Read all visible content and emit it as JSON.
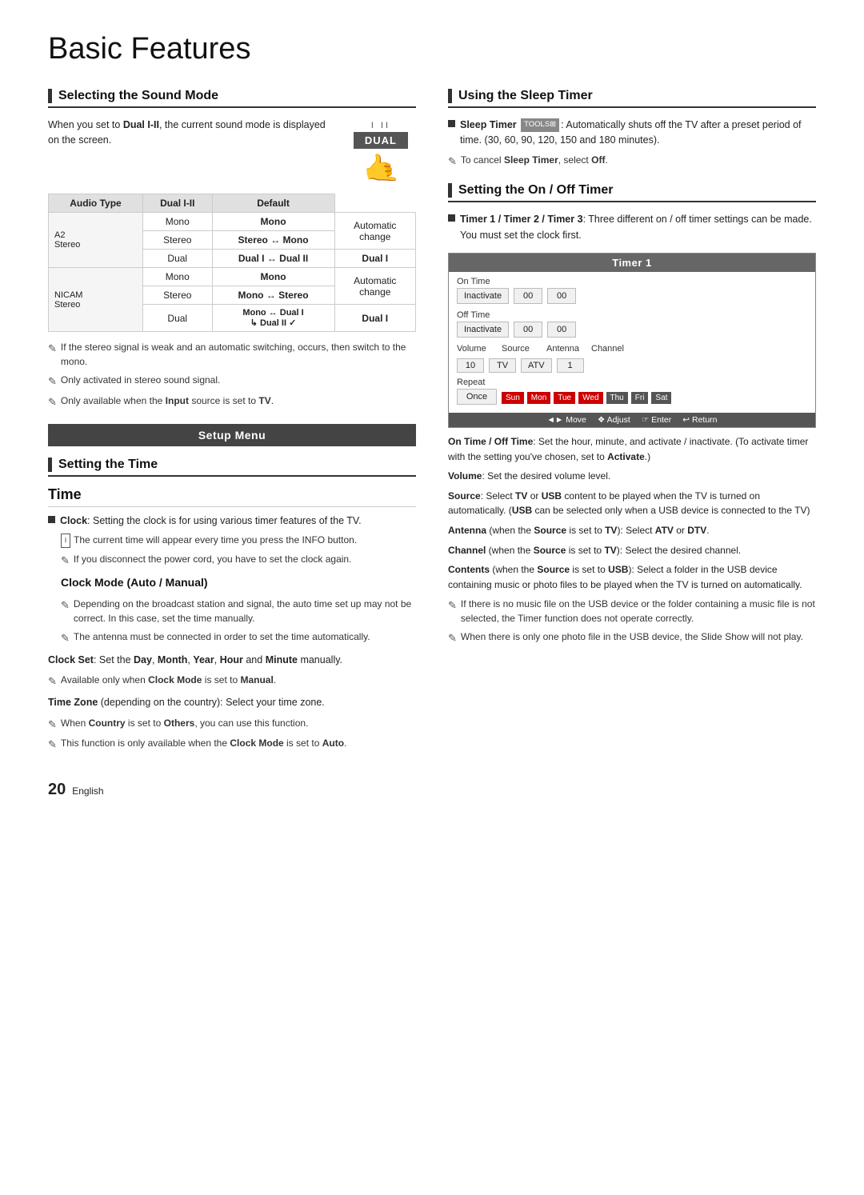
{
  "page": {
    "title": "Basic Features",
    "page_number": "20",
    "language": "English"
  },
  "left_col": {
    "section1": {
      "title": "Selecting the Sound Mode",
      "intro": "When you set to Dual I-II, the current sound mode is displayed on the screen.",
      "dual_label_top": "I  II",
      "dual_badge": "DUAL",
      "table": {
        "headers": [
          "Audio Type",
          "Dual I-II",
          "Default"
        ],
        "groups": [
          {
            "group_label": "A2 Stereo",
            "rows": [
              {
                "sub": "Mono",
                "dual": "Mono",
                "default": "Automatic"
              },
              {
                "sub": "Stereo",
                "dual": "Stereo ↔ Mono",
                "default": "change"
              },
              {
                "sub": "Dual",
                "dual": "Dual I ↔ Dual II",
                "default": "Dual I"
              }
            ]
          },
          {
            "group_label": "NICAM Stereo",
            "rows": [
              {
                "sub": "Mono",
                "dual": "Mono",
                "default": "Automatic"
              },
              {
                "sub": "Stereo",
                "dual": "Mono ↔ Stereo",
                "default": "change"
              },
              {
                "sub": "Dual",
                "dual": "Mono ↔ Dual I  ↳ Dual II ✓",
                "default": "Dual I"
              }
            ]
          }
        ]
      },
      "notes": [
        "If the stereo signal is weak and an automatic switching, occurs, then switch to the mono.",
        "Only activated in stereo sound signal.",
        "Only available when the Input source is set to TV."
      ]
    },
    "setup_menu_label": "Setup Menu",
    "section2": {
      "title": "Setting the Time",
      "subsection": "Time",
      "clock_note": "Clock: Setting the clock is for using various timer features of the TV.",
      "info_note": "The current time will appear every time you press the INFO button.",
      "note1": "If you disconnect the power cord, you have to set the clock again.",
      "clock_mode_label": "Clock Mode (Auto / Manual)",
      "clock_mode_notes": [
        "Depending on the broadcast station and signal, the auto time set up may not be correct. In this case, set the time manually.",
        "The antenna must be connected in order to set the time automatically."
      ],
      "clock_set_text": "Clock Set: Set the Day, Month, Year, Hour and Minute manually.",
      "clock_set_note": "Available only when Clock Mode is set to Manual.",
      "timezone_text": "Time Zone (depending on the country): Select your time zone.",
      "timezone_notes": [
        "When Country is set to Others, you can use this function.",
        "This function is only available when the Clock Mode is set to Auto."
      ]
    }
  },
  "right_col": {
    "section3": {
      "title": "Using the Sleep Timer",
      "bullet": "Sleep Timer TOOLS: Automatically shuts off the TV after a preset period of time. (30, 60, 90, 120, 150 and 180 minutes).",
      "note": "To cancel Sleep Timer, select Off."
    },
    "section4": {
      "title": "Setting the On / Off Timer",
      "bullet": "Timer 1 / Timer 2 / Timer 3: Three different on / off timer settings can be made. You must set the clock first.",
      "timer_title": "Timer 1",
      "timer": {
        "on_time_label": "On Time",
        "on_inactivate": "Inactivate",
        "on_00_1": "00",
        "on_00_2": "00",
        "off_time_label": "Off Time",
        "off_inactivate": "Inactivate",
        "off_00_1": "00",
        "off_00_2": "00",
        "volume_label": "Volume",
        "volume_val": "10",
        "source_label": "Source",
        "source_val": "TV",
        "antenna_label": "Antenna",
        "antenna_val": "ATV",
        "channel_label": "Channel",
        "channel_val": "1",
        "repeat_label": "Repeat",
        "repeat_val": "Once",
        "days": [
          "Sun",
          "Mon",
          "Tue",
          "Wed",
          "Thu",
          "Fri",
          "Sat"
        ],
        "footer": "◄► Move  ❖ Adjust  ☞ Enter  ↩ Return"
      },
      "body_texts": [
        "On Time / Off Time: Set the hour, minute, and activate / inactivate. (To activate timer with the setting you've chosen, set to Activate.)",
        "Volume: Set the desired volume level.",
        "Source: Select TV or USB content to be played when the TV is turned on automatically. (USB can be selected only when a USB device is connected to the TV)",
        "Antenna (when the Source is set to TV): Select ATV or DTV.",
        "Channel (when the Source is set to TV): Select the desired channel.",
        "Contents (when the Source is set to USB): Select a folder in the USB device containing music or photo files to be played when the TV is turned on automatically.",
        "If there is no music file on the USB device or the folder containing a music file is not selected, the Timer function does not operate correctly.",
        "When there is only one photo file in the USB device, the Slide Show will not play."
      ]
    }
  }
}
